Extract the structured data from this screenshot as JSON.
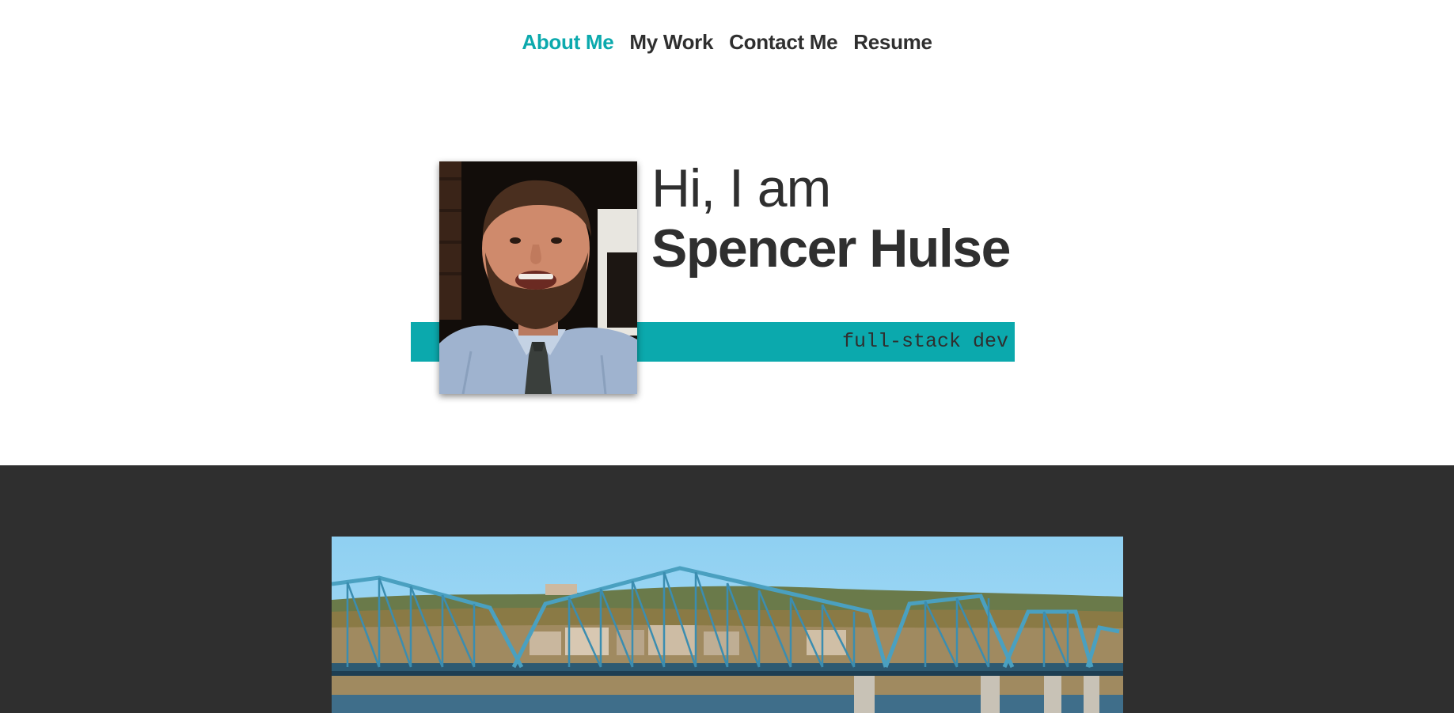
{
  "nav": {
    "items": [
      {
        "label": "About Me",
        "active": true
      },
      {
        "label": "My Work",
        "active": false
      },
      {
        "label": "Contact Me",
        "active": false
      },
      {
        "label": "Resume",
        "active": false
      }
    ]
  },
  "hero": {
    "greeting": "Hi, I am",
    "name": "Spencer Hulse",
    "tagline": "full-stack dev"
  },
  "colors": {
    "accent": "#0ba9ad",
    "text": "#2f2f2f",
    "dark_section": "#2f2f2f"
  }
}
